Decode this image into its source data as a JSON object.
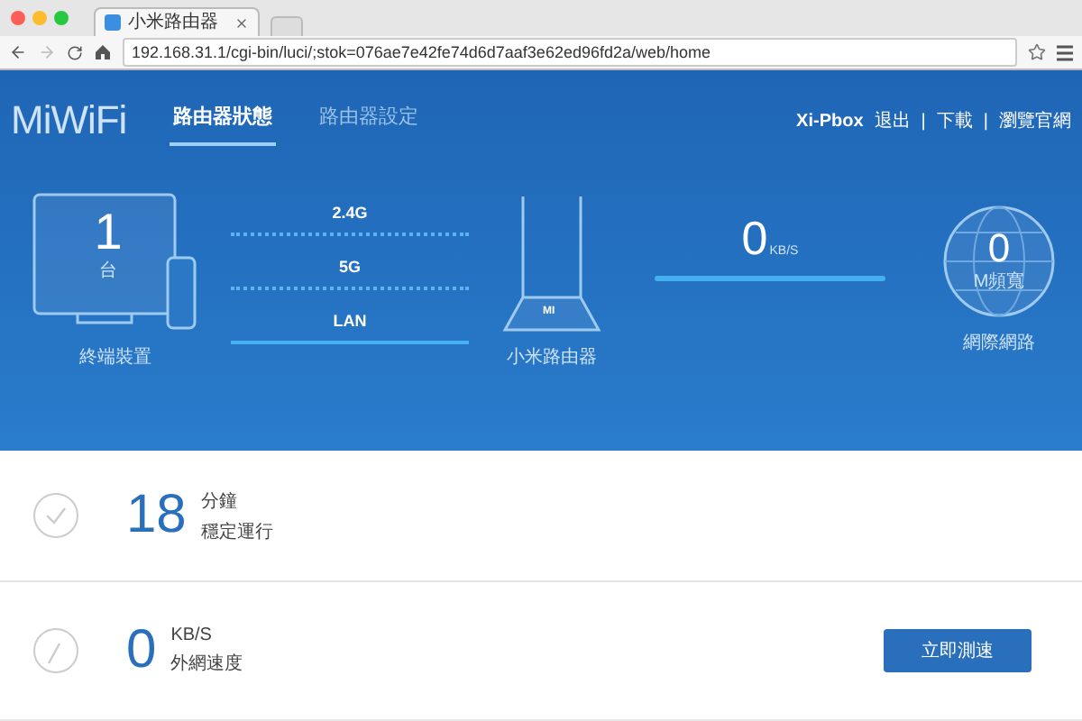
{
  "browser": {
    "tab_title": "小米路由器",
    "url": "192.168.31.1/cgi-bin/luci/;stok=076ae7e42fe74d6d7aaf3e62ed96fd2a/web/home"
  },
  "header": {
    "logo": "MiWiFi",
    "tabs": [
      {
        "label": "路由器狀態",
        "selected": true
      },
      {
        "label": "路由器設定",
        "selected": false
      }
    ],
    "user": "Xi-Pbox",
    "links": [
      "退出",
      "下載",
      "瀏覽官網"
    ],
    "separators": [
      "|",
      "|"
    ]
  },
  "devices": {
    "count": "1",
    "unit": "台",
    "label": "終端裝置"
  },
  "connections": [
    {
      "label": "2.4G",
      "kind": "dotted"
    },
    {
      "label": "5G",
      "kind": "dotted"
    },
    {
      "label": "LAN",
      "kind": "solid"
    }
  ],
  "router": {
    "badge": "MI",
    "label": "小米路由器"
  },
  "traffic": {
    "value": "0",
    "unit": "KB/S"
  },
  "internet": {
    "value": "0",
    "unit": "M頻寬",
    "label": "網際網路"
  },
  "stats": [
    {
      "kind": "uptime",
      "value": "18",
      "unit": "分鐘",
      "label": "穩定運行"
    },
    {
      "kind": "speed",
      "value": "0",
      "unit": "KB/S",
      "label": "外網速度",
      "button": "立即測速"
    }
  ]
}
